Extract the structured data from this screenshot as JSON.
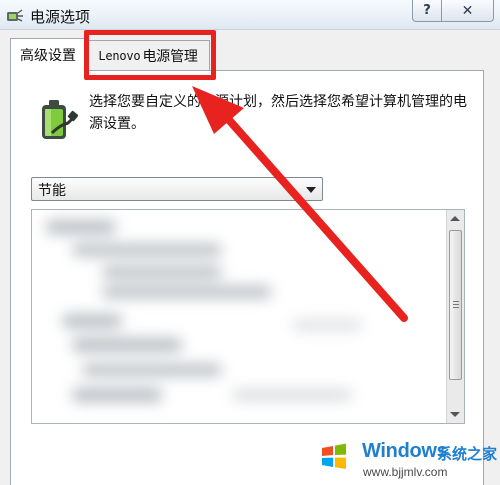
{
  "window": {
    "title": "电源选项",
    "help_label": "?",
    "close_label": "✕",
    "icon": "power-options-icon"
  },
  "tabs": [
    {
      "label": "高级设置",
      "active": true
    },
    {
      "label_latin": "Lenovo",
      "label_cjk": "电源管理",
      "active": false
    }
  ],
  "main": {
    "description": "选择您要自定义的电源计划，然后选择您希望计算机管理的电源设置。",
    "plan_select": {
      "value": "节能"
    }
  },
  "annotation": {
    "color": "#e8231f"
  },
  "watermark": {
    "title": "Windows",
    "subtitle": "系统之家",
    "url": "www.bjjmlv.com"
  },
  "colors": {
    "accent": "#e8231f",
    "watermark_blue": "#1f7fd0",
    "window_bg": "#f0f0f0"
  }
}
